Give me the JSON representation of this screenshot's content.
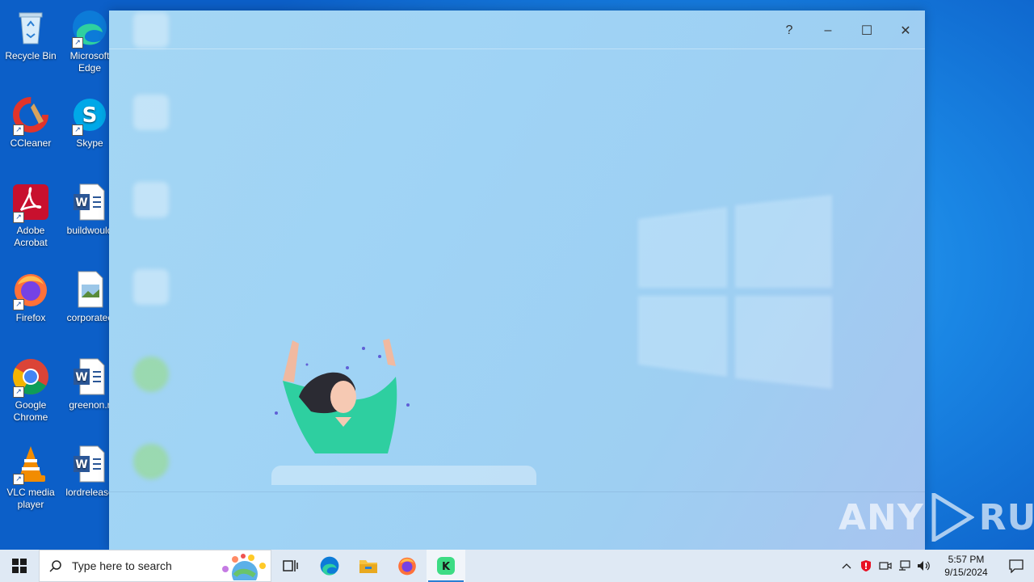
{
  "desktop": {
    "icons": [
      {
        "label": "Recycle Bin",
        "icon": "recycle-bin-icon"
      },
      {
        "label": "Microsoft Edge",
        "icon": "edge-icon"
      },
      {
        "label": "CCleaner",
        "icon": "ccleaner-icon"
      },
      {
        "label": "Skype",
        "icon": "skype-icon"
      },
      {
        "label": "Adobe Acrobat",
        "icon": "acrobat-icon"
      },
      {
        "label": "buildwould",
        "icon": "word-doc-icon"
      },
      {
        "label": "Firefox",
        "icon": "firefox-icon"
      },
      {
        "label": "corporatec",
        "icon": "image-file-icon"
      },
      {
        "label": "Google Chrome",
        "icon": "chrome-icon"
      },
      {
        "label": "greenon.r",
        "icon": "word-doc-icon"
      },
      {
        "label": "VLC media player",
        "icon": "vlc-icon"
      },
      {
        "label": "lordrelease",
        "icon": "word-doc-icon"
      }
    ]
  },
  "dialog": {
    "controls": {
      "help": "?",
      "minimize": "–",
      "maximize": "☐",
      "close": "✕"
    }
  },
  "watermark": {
    "text_left": "ANY",
    "text_right": "RUN"
  },
  "taskbar": {
    "search_placeholder": "Type here to search",
    "pinned": [
      "task-view-icon",
      "edge-icon",
      "file-explorer-icon",
      "firefox-icon",
      "kaspersky-icon"
    ],
    "clock": {
      "time": "5:57 PM",
      "date": "9/15/2024"
    }
  },
  "colors": {
    "desktop_blue": "#1a86e4",
    "dialog_bg": "#a4d6f4",
    "taskbar_bg": "#dfe9f4",
    "illustration_green": "#2ecfa0"
  }
}
